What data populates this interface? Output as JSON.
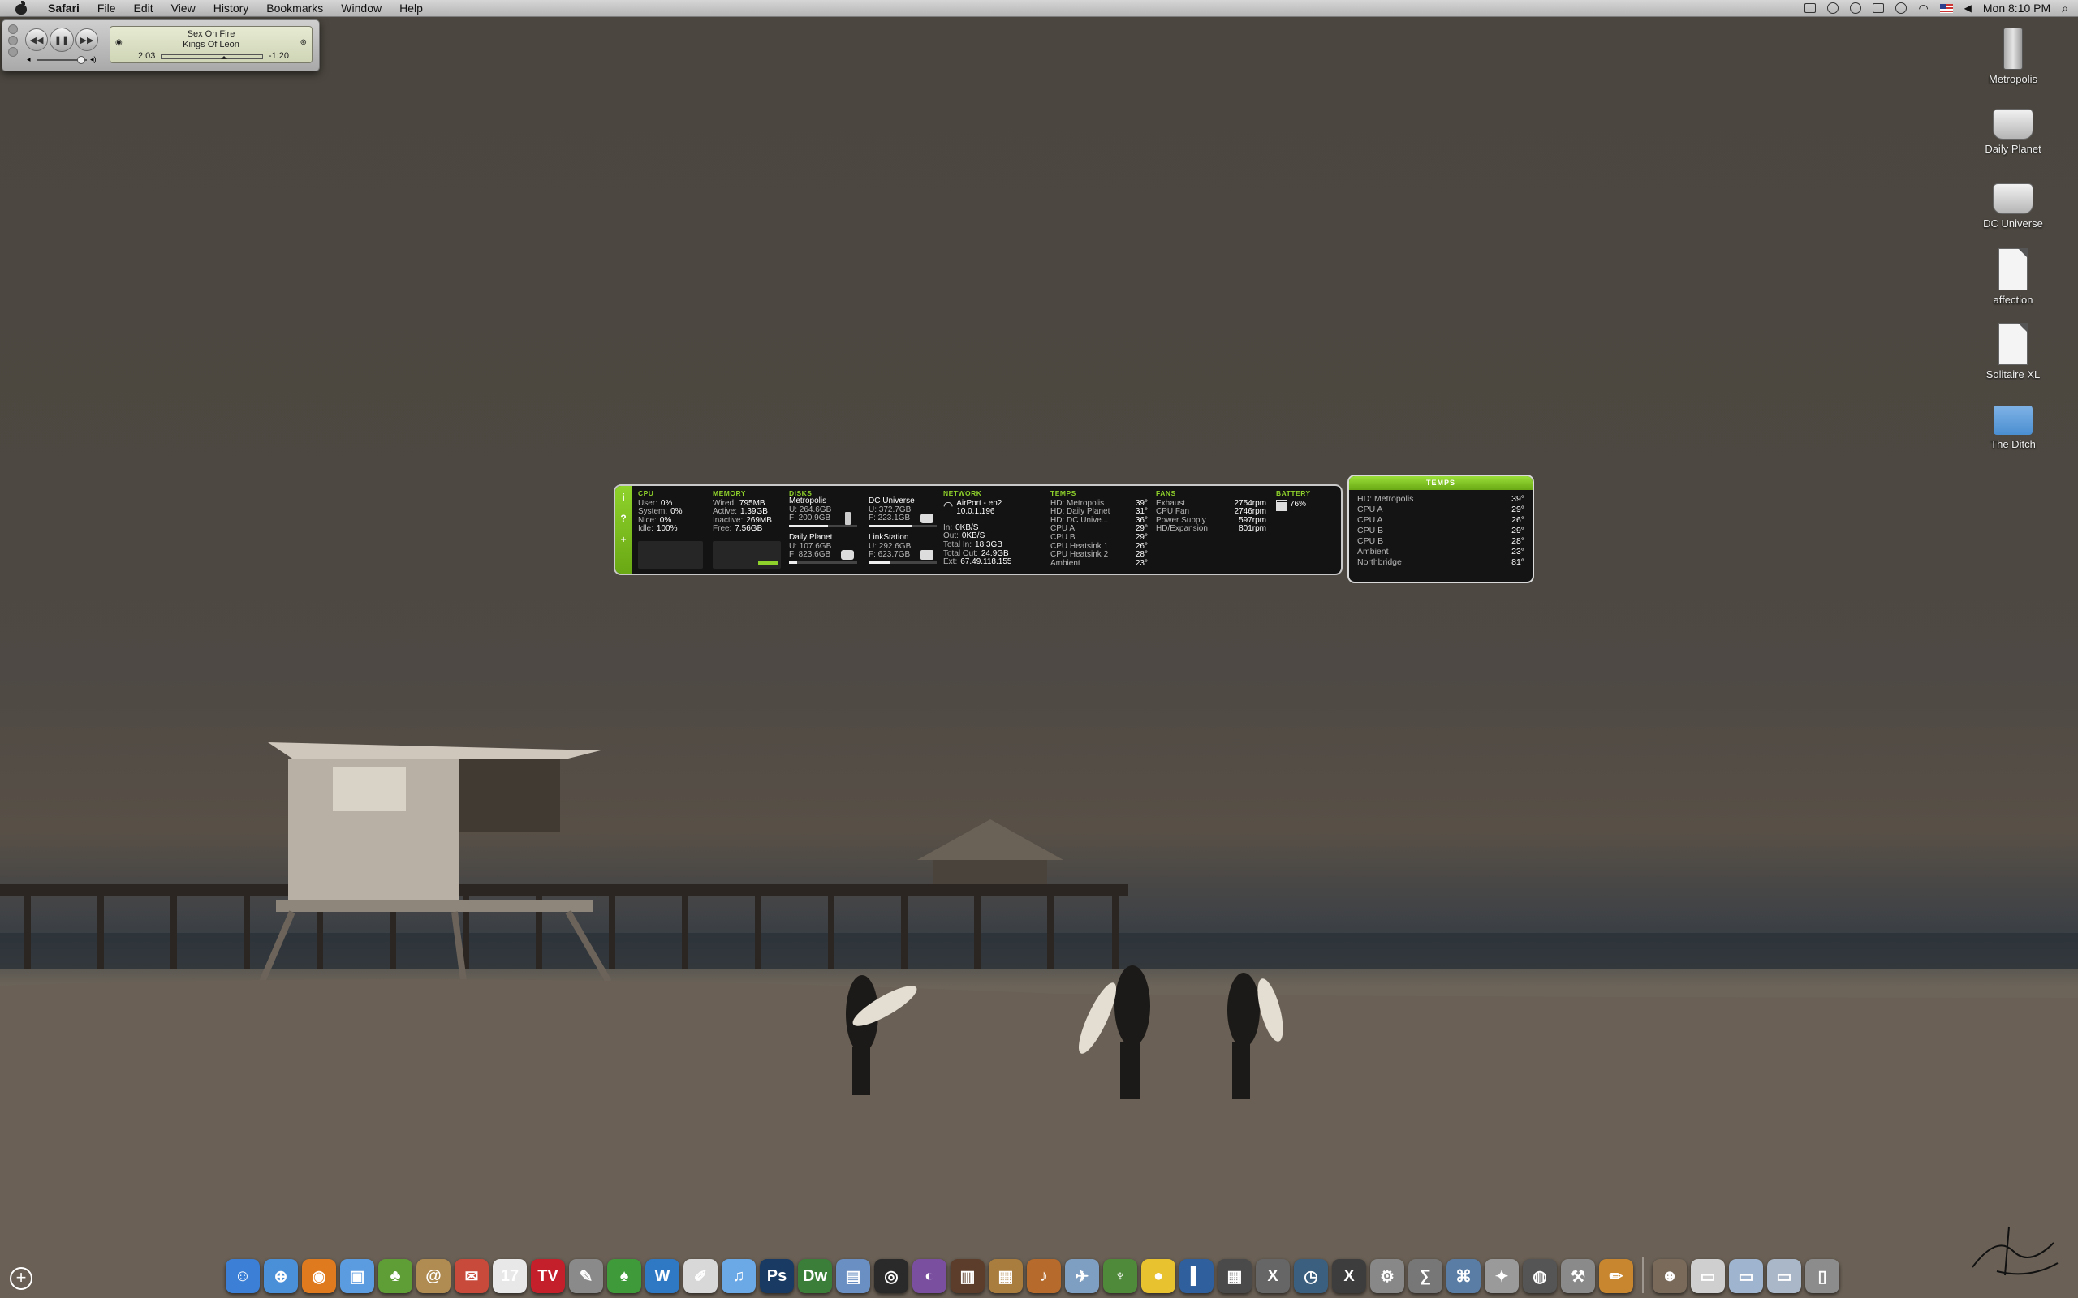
{
  "menubar": {
    "app": "Safari",
    "items": [
      "File",
      "Edit",
      "View",
      "History",
      "Bookmarks",
      "Window",
      "Help"
    ],
    "clock": "Mon 8:10 PM"
  },
  "itunes": {
    "title": "Sex On Fire",
    "artist": "Kings Of Leon",
    "elapsed": "2:03",
    "remaining": "-1:20",
    "progress": 0.63
  },
  "desktop_icons": [
    {
      "label": "Metropolis",
      "icon": "hard-drive-icon"
    },
    {
      "label": "Daily Planet",
      "icon": "apple-disk-icon"
    },
    {
      "label": "DC Universe",
      "icon": "apple-disk-icon"
    },
    {
      "label": "affection",
      "icon": "document-icon"
    },
    {
      "label": "Solitaire XL",
      "icon": "app-icon"
    },
    {
      "label": "The Ditch",
      "icon": "folder-icon"
    }
  ],
  "istat": {
    "cpu": {
      "title": "CPU",
      "rows": [
        [
          "User:",
          "0%"
        ],
        [
          "System:",
          "0%"
        ],
        [
          "Nice:",
          "0%"
        ],
        [
          "Idle:",
          "100%"
        ]
      ]
    },
    "memory": {
      "title": "MEMORY",
      "rows": [
        [
          "Wired:",
          "795MB"
        ],
        [
          "Active:",
          "1.39GB"
        ],
        [
          "Inactive:",
          "269MB"
        ],
        [
          "Free:",
          "7.56GB"
        ]
      ]
    },
    "disks": {
      "title": "DISKS",
      "items": [
        {
          "name": "Metropolis",
          "u": "U: 264.6GB",
          "f": "F: 200.9GB",
          "fill": 0.57
        },
        {
          "name": "DC Universe",
          "u": "U: 372.7GB",
          "f": "F: 223.1GB",
          "fill": 0.63
        },
        {
          "name": "Daily Planet",
          "u": "U: 107.6GB",
          "f": "F: 823.6GB",
          "fill": 0.12
        },
        {
          "name": "LinkStation",
          "u": "U: 292.6GB",
          "f": "F: 623.7GB",
          "fill": 0.32
        }
      ]
    },
    "network": {
      "title": "NETWORK",
      "iface": "AirPort - en2",
      "ip": "10.0.1.196",
      "rows": [
        [
          "In:",
          "0KB/S"
        ],
        [
          "Out:",
          "0KB/S"
        ],
        [
          "Total In:",
          "18.3GB"
        ],
        [
          "Total Out:",
          "24.9GB"
        ],
        [
          "Ext:",
          "67.49.118.155"
        ]
      ]
    },
    "temps": {
      "title": "TEMPS",
      "rows": [
        [
          "HD: Metropolis",
          "39°"
        ],
        [
          "HD: Daily Planet",
          "31°"
        ],
        [
          "HD: DC Unive...",
          "36°"
        ],
        [
          "CPU A",
          "29°"
        ],
        [
          "CPU B",
          "29°"
        ],
        [
          "CPU Heatsink 1",
          "26°"
        ],
        [
          "CPU Heatsink 2",
          "28°"
        ],
        [
          "Ambient",
          "23°"
        ]
      ]
    },
    "fans": {
      "title": "FANS",
      "rows": [
        [
          "Exhaust",
          "2754rpm"
        ],
        [
          "CPU Fan",
          "2746rpm"
        ],
        [
          "Power Supply",
          "597rpm"
        ],
        [
          "HD/Expansion",
          "801rpm"
        ]
      ]
    },
    "battery": {
      "title": "BATTERY",
      "value": "76%",
      "level": 0.76
    }
  },
  "temps_widget": {
    "title": "TEMPS",
    "rows": [
      [
        "HD: Metropolis",
        "39°"
      ],
      [
        "CPU A",
        "29°"
      ],
      [
        "CPU A",
        "26°"
      ],
      [
        "CPU B",
        "29°"
      ],
      [
        "CPU B",
        "28°"
      ],
      [
        "Ambient",
        "23°"
      ],
      [
        "Northbridge",
        "81°"
      ]
    ]
  },
  "dock": [
    {
      "name": "finder-icon",
      "color": "#3b7fd6",
      "glyph": "☺"
    },
    {
      "name": "safari-icon",
      "color": "#4a90d9",
      "glyph": "⊕"
    },
    {
      "name": "firefox-icon",
      "color": "#e07a1f",
      "glyph": "◉"
    },
    {
      "name": "ichat-icon",
      "color": "#5b9be0",
      "glyph": "▣"
    },
    {
      "name": "growl-icon",
      "color": "#5f9d36",
      "glyph": "♣"
    },
    {
      "name": "address-book-icon",
      "color": "#b08c52",
      "glyph": "@"
    },
    {
      "name": "mail-stamp-icon",
      "color": "#c74a3b",
      "glyph": "✉"
    },
    {
      "name": "ical-icon",
      "color": "#e8e8e8",
      "glyph": "17"
    },
    {
      "name": "tv-icon",
      "color": "#c4202c",
      "glyph": "TV"
    },
    {
      "name": "script-icon",
      "color": "#8a8a8a",
      "glyph": "✎"
    },
    {
      "name": "leaf-icon",
      "color": "#3f9b3a",
      "glyph": "♠"
    },
    {
      "name": "app-blue-icon",
      "color": "#2f78c4",
      "glyph": "W"
    },
    {
      "name": "textedit-icon",
      "color": "#d8d8d8",
      "glyph": "✐"
    },
    {
      "name": "itunes-icon",
      "color": "#6aa9e6",
      "glyph": "♫"
    },
    {
      "name": "photoshop-icon",
      "color": "#183a63",
      "glyph": "Ps"
    },
    {
      "name": "dreamweaver-icon",
      "color": "#3b7e3a",
      "glyph": "Dw"
    },
    {
      "name": "preview-icon",
      "color": "#6a8fc2",
      "glyph": "▤"
    },
    {
      "name": "aperture-icon",
      "color": "#2a2a2a",
      "glyph": "◎"
    },
    {
      "name": "colorsync-icon",
      "color": "#7a4fa0",
      "glyph": "◐"
    },
    {
      "name": "bookshelf-icon",
      "color": "#5c3c2a",
      "glyph": "▥"
    },
    {
      "name": "photo-icon",
      "color": "#a97d3e",
      "glyph": "▦"
    },
    {
      "name": "guitar-icon",
      "color": "#b66a2b",
      "glyph": "♪"
    },
    {
      "name": "airplane-icon",
      "color": "#7f9fc2",
      "glyph": "✈"
    },
    {
      "name": "palm-icon",
      "color": "#4f8a3a",
      "glyph": "♆"
    },
    {
      "name": "duck-icon",
      "color": "#e9c230",
      "glyph": "●"
    },
    {
      "name": "book-icon",
      "color": "#2f5f9c",
      "glyph": "▌"
    },
    {
      "name": "spaces-icon",
      "color": "#4a4a4a",
      "glyph": "▦"
    },
    {
      "name": "x11-icon",
      "color": "#666",
      "glyph": "X"
    },
    {
      "name": "time-machine-icon",
      "color": "#3a5f7f",
      "glyph": "◷"
    },
    {
      "name": "osx-icon",
      "color": "#3d3d3d",
      "glyph": "X"
    },
    {
      "name": "system-prefs-icon",
      "color": "#888",
      "glyph": "⚙"
    },
    {
      "name": "calculator-icon",
      "color": "#777",
      "glyph": "∑"
    },
    {
      "name": "network-icon",
      "color": "#5a7da5",
      "glyph": "⌘"
    },
    {
      "name": "pref-pane-icon",
      "color": "#9a9a9a",
      "glyph": "✦"
    },
    {
      "name": "camera-icon",
      "color": "#555",
      "glyph": "◍"
    },
    {
      "name": "utility-icon",
      "color": "#8a8a8a",
      "glyph": "⚒"
    },
    {
      "name": "pencil-icon",
      "color": "#c8862f",
      "glyph": "✏"
    },
    {
      "name": "photo-portrait-icon",
      "color": "#7a6a5a",
      "glyph": "☻"
    },
    {
      "name": "document-stack-icon",
      "color": "#cfcfcf",
      "glyph": "▭"
    },
    {
      "name": "downloads-folder-icon",
      "color": "#9fb4cf",
      "glyph": "▭"
    },
    {
      "name": "applications-folder-icon",
      "color": "#a9b7c8",
      "glyph": "▭"
    },
    {
      "name": "trash-icon",
      "color": "#8c8c8c",
      "glyph": "▯"
    }
  ]
}
